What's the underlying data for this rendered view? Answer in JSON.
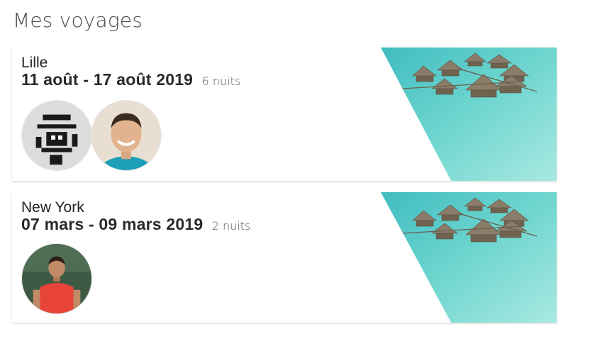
{
  "page": {
    "title": "Mes voyages"
  },
  "trips": [
    {
      "city": "Lille",
      "dates": "11 août - 17 août 2019",
      "nights": "6 nuits",
      "travelers": [
        "avatar-abstract",
        "avatar-man-smiling"
      ]
    },
    {
      "city": "New York",
      "dates": "07 mars - 09 mars 2019",
      "nights": "2 nuits",
      "travelers": [
        "avatar-man-red-shirt"
      ]
    }
  ],
  "colors": {
    "lagoon": "#5fd0cc",
    "lagoon_light": "#a9e8e2",
    "hut_roof": "#8a7c68",
    "card_bg": "#ffffff",
    "title": "#4a4a4a"
  }
}
